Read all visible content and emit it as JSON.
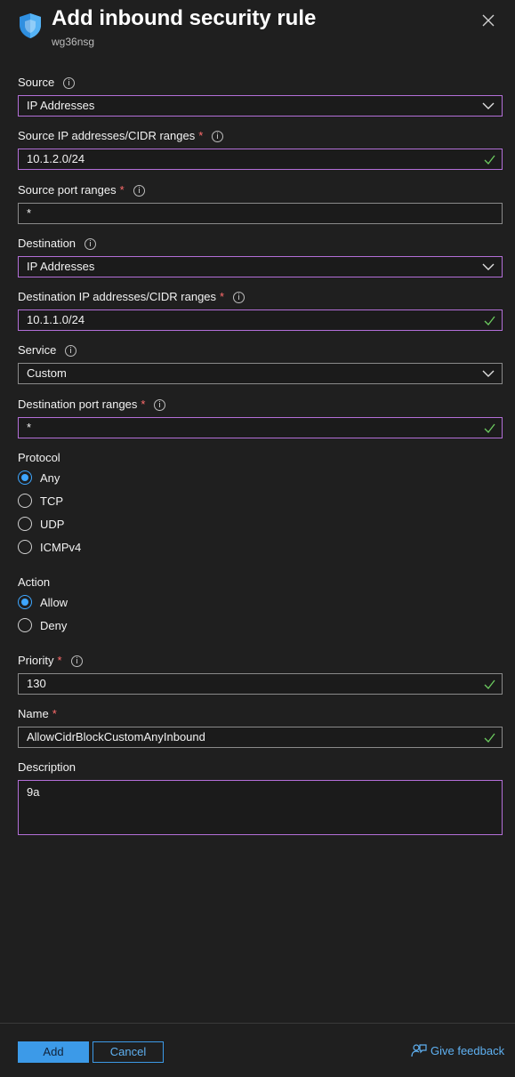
{
  "header": {
    "title": "Add inbound security rule",
    "subtitle": "wg36nsg"
  },
  "form": {
    "source": {
      "label": "Source",
      "value": "IP Addresses"
    },
    "source_ip": {
      "label": "Source IP addresses/CIDR ranges",
      "required": "*",
      "value": "10.1.2.0/24"
    },
    "source_port": {
      "label": "Source port ranges",
      "required": "*",
      "value": "*"
    },
    "destination": {
      "label": "Destination",
      "value": "IP Addresses"
    },
    "destination_ip": {
      "label": "Destination IP addresses/CIDR ranges",
      "required": "*",
      "value": "10.1.1.0/24"
    },
    "service": {
      "label": "Service",
      "value": "Custom"
    },
    "destination_port": {
      "label": "Destination port ranges",
      "required": "*",
      "value": "*"
    },
    "protocol": {
      "label": "Protocol",
      "options": [
        "Any",
        "TCP",
        "UDP",
        "ICMPv4"
      ],
      "selected": "Any"
    },
    "action": {
      "label": "Action",
      "options": [
        "Allow",
        "Deny"
      ],
      "selected": "Allow"
    },
    "priority": {
      "label": "Priority",
      "required": "*",
      "value": "130"
    },
    "name": {
      "label": "Name",
      "required": "*",
      "value": "AllowCidrBlockCustomAnyInbound"
    },
    "description": {
      "label": "Description",
      "value": "9a"
    }
  },
  "footer": {
    "add_label": "Add",
    "cancel_label": "Cancel",
    "feedback_label": "Give feedback"
  },
  "colors": {
    "accent": "#3c9ae8",
    "focus_border": "#b36fd8",
    "valid_check": "#6ccb5f",
    "required": "#ff6b6b"
  }
}
